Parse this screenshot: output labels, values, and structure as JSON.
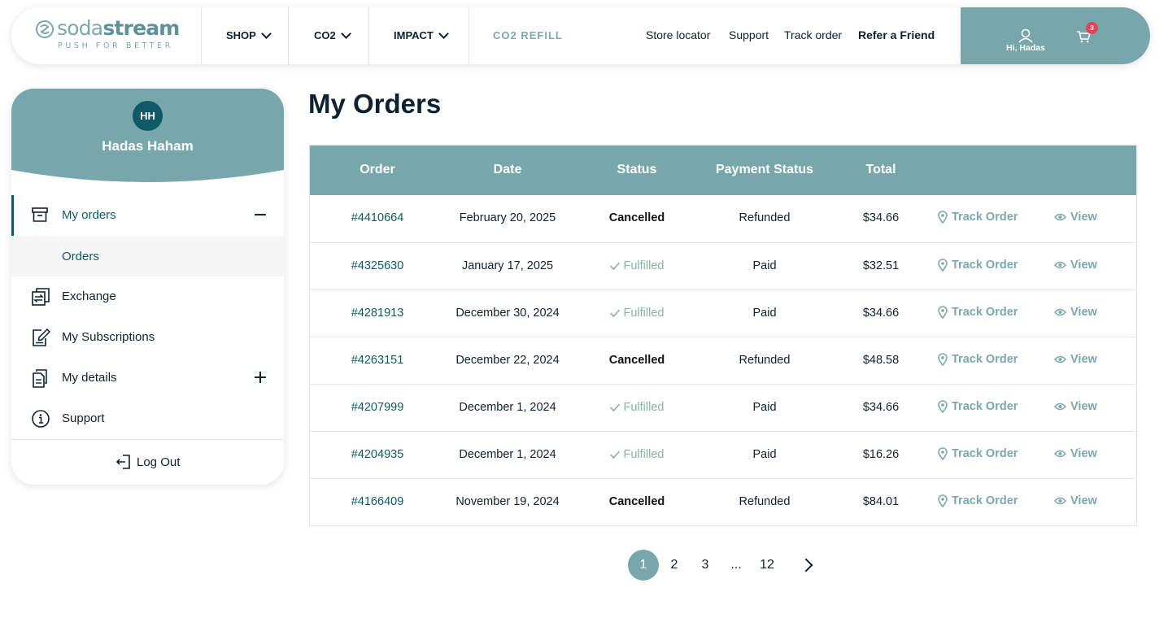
{
  "brand": {
    "name": "sodastream",
    "name_part1": "soda",
    "name_part2": "stream",
    "tagline": "PUSH FOR BETTER"
  },
  "nav": {
    "shop": "SHOP",
    "co2": "CO2",
    "impact": "IMPACT",
    "co2_refill": "CO2 REFILL"
  },
  "utility": {
    "store_locator": "Store locator",
    "support": "Support",
    "track_order": "Track order",
    "refer": "Refer a Friend"
  },
  "account": {
    "greeting": "Hi, Hadas",
    "cart_count": "3"
  },
  "profile": {
    "initials": "HH",
    "name": "Hadas Haham"
  },
  "sidebar": {
    "items": [
      {
        "label": "My orders",
        "icon": "archive-box-icon"
      },
      {
        "label": "Orders"
      },
      {
        "label": "Exchange",
        "icon": "exchange-icon"
      },
      {
        "label": "My Subscriptions",
        "icon": "edit-document-icon"
      },
      {
        "label": "My details",
        "icon": "documents-icon"
      },
      {
        "label": "Support",
        "icon": "info-icon"
      }
    ],
    "logout": "Log Out"
  },
  "main": {
    "title": "My Orders",
    "columns": [
      "Order",
      "Date",
      "Status",
      "Payment Status",
      "Total"
    ],
    "track_label": "Track Order",
    "view_label": "View",
    "orders": [
      {
        "id": "#4410664",
        "date": "February 20, 2025",
        "status": "Cancelled",
        "payment": "Refunded",
        "total": "$34.66"
      },
      {
        "id": "#4325630",
        "date": "January 17, 2025",
        "status": "Fulfilled",
        "payment": "Paid",
        "total": "$32.51"
      },
      {
        "id": "#4281913",
        "date": "December 30, 2024",
        "status": "Fulfilled",
        "payment": "Paid",
        "total": "$34.66"
      },
      {
        "id": "#4263151",
        "date": "December 22, 2024",
        "status": "Cancelled",
        "payment": "Refunded",
        "total": "$48.58"
      },
      {
        "id": "#4207999",
        "date": "December 1, 2024",
        "status": "Fulfilled",
        "payment": "Paid",
        "total": "$34.66"
      },
      {
        "id": "#4204935",
        "date": "December 1, 2024",
        "status": "Fulfilled",
        "payment": "Paid",
        "total": "$16.26"
      },
      {
        "id": "#4166409",
        "date": "November 19, 2024",
        "status": "Cancelled",
        "payment": "Refunded",
        "total": "$84.01"
      }
    ]
  },
  "pagination": {
    "pages": [
      "1",
      "2",
      "3",
      "...",
      "12"
    ],
    "current": "1"
  },
  "colors": {
    "accent": "#78a7ab",
    "dark_teal": "#0f5a66",
    "text": "#0d2230",
    "fulfilled": "#8ab39c",
    "badge": "#e0465a"
  }
}
